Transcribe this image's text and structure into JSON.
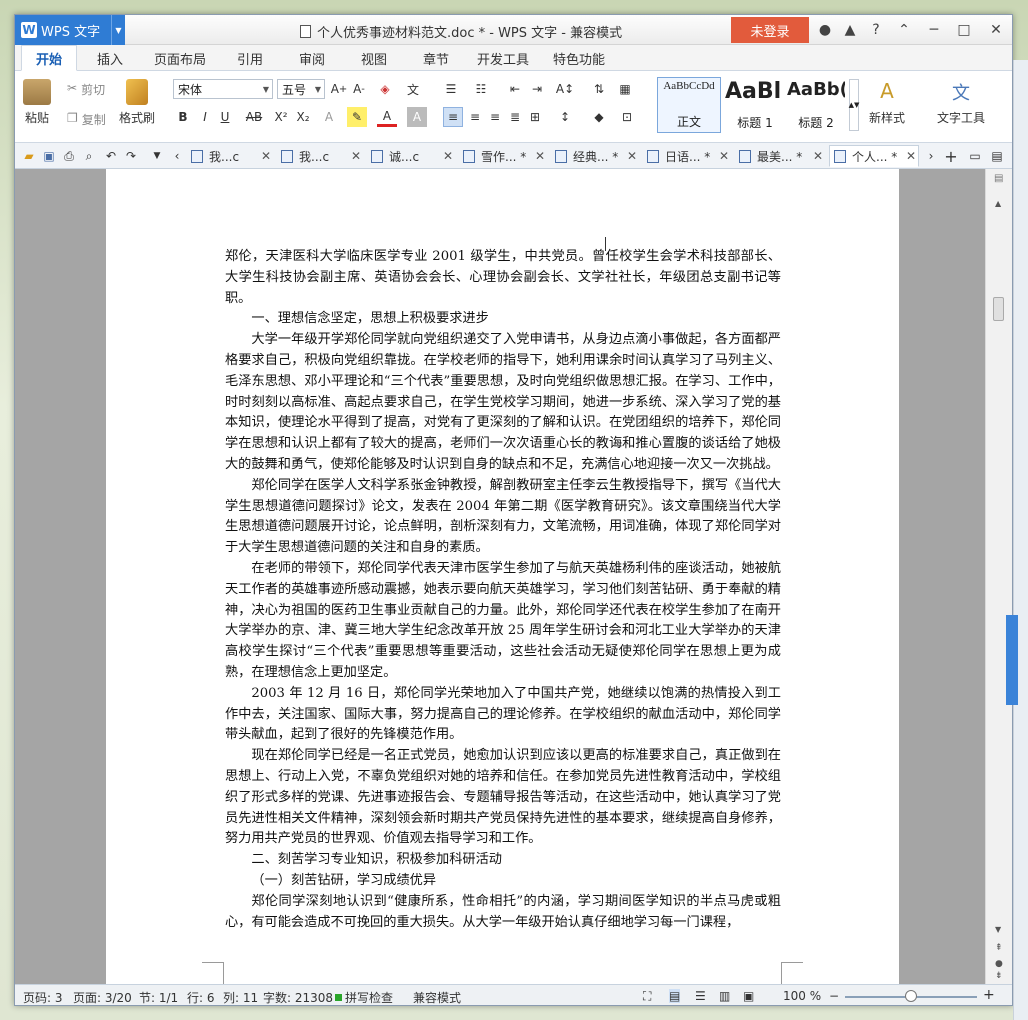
{
  "app": {
    "name": "WPS 文字",
    "logo_letter": "W",
    "doc_title": "个人优秀事迹材料范文.doc * - WPS 文字 - 兼容模式",
    "login_label": "未登录"
  },
  "menu": {
    "tabs": [
      "开始",
      "插入",
      "页面布局",
      "引用",
      "审阅",
      "视图",
      "章节",
      "开发工具",
      "特色功能"
    ],
    "active": "开始"
  },
  "ribbon": {
    "paste": "粘贴",
    "cut": "剪切",
    "copy": "复制",
    "format_painter": "格式刷",
    "font_name": "宋体",
    "font_size": "五号",
    "styles": [
      {
        "preview": "AaBbCcDd",
        "label": "正文"
      },
      {
        "preview": "AaBl",
        "label": "标题 1"
      },
      {
        "preview": "AaBb(",
        "label": "标题 2"
      }
    ],
    "new_style": "新样式",
    "text_tools": "文字工具"
  },
  "doc_tabs": [
    {
      "label": "我...c"
    },
    {
      "label": "我...c"
    },
    {
      "label": "诚...c"
    },
    {
      "label": "雪作... *"
    },
    {
      "label": "经典... *"
    },
    {
      "label": "日语... *"
    },
    {
      "label": "最美... *"
    },
    {
      "label": "个人... *",
      "active": true
    }
  ],
  "document": {
    "paragraphs": [
      {
        "text": "郑伦，天津医科大学临床医学专业 2001 级学生，中共党员。曾任校学生会学术科技部部长、大学生科技协会副主席、英语协会会长、心理协会副会长、文学社社长，年级团总支副书记等职。",
        "indent": false
      },
      {
        "text": "一、理想信念坚定，思想上积极要求进步",
        "indent": true
      },
      {
        "text": "大学一年级开学郑伦同学就向党组织递交了入党申请书，从身边点滴小事做起，各方面都严格要求自己，积极向党组织靠拢。在学校老师的指导下，她利用课余时间认真学习了马列主义、毛泽东思想、邓小平理论和“三个代表”重要思想，及时向党组织做思想汇报。在学习、工作中，时时刻刻以高标准、高起点要求自己，在学生党校学习期间，她进一步系统、深入学习了党的基本知识，使理论水平得到了提高，对党有了更深刻的了解和认识。在党团组织的培养下，郑伦同学在思想和认识上都有了较大的提高，老师们一次次语重心长的教诲和推心置腹的谈话给了她极大的鼓舞和勇气，使郑伦能够及时认识到自身的缺点和不足，充满信心地迎接一次又一次挑战。",
        "indent": true
      },
      {
        "text": "郑伦同学在医学人文科学系张金钟教授，解剖教研室主任李云生教授指导下，撰写《当代大学生思想道德问题探讨》论文，发表在 2004 年第二期《医学教育研究》。该文章围绕当代大学生思想道德问题展开讨论，论点鲜明，剖析深刻有力，文笔流畅，用词准确，体现了郑伦同学对于大学生思想道德问题的关注和自身的素质。",
        "indent": true
      },
      {
        "text": "在老师的带领下，郑伦同学代表天津市医学生参加了与航天英雄杨利伟的座谈活动，她被航天工作者的英雄事迹所感动震撼，她表示要向航天英雄学习，学习他们刻苦钻研、勇于奉献的精神，决心为祖国的医药卫生事业贡献自己的力量。此外，郑伦同学还代表在校学生参加了在南开大学举办的京、津、冀三地大学生纪念改革开放 25 周年学生研讨会和河北工业大学举办的天津高校学生探讨“三个代表”重要思想等重要活动，这些社会活动无疑使郑伦同学在思想上更为成熟，在理想信念上更加坚定。",
        "indent": true
      },
      {
        "text": "2003 年 12 月 16 日，郑伦同学光荣地加入了中国共产党，她继续以饱满的热情投入到工作中去，关注国家、国际大事，努力提高自己的理论修养。在学校组织的献血活动中，郑伦同学带头献血，起到了很好的先锋模范作用。",
        "indent": true
      },
      {
        "text": "现在郑伦同学已经是一名正式党员，她愈加认识到应该以更高的标准要求自己，真正做到在思想上、行动上入党，不辜负党组织对她的培养和信任。在参加党员先进性教育活动中，学校组织了形式多样的党课、先进事迹报告会、专题辅导报告等活动，在这些活动中，她认真学习了党员先进性相关文件精神，深刻领会新时期共产党员保持先进性的基本要求，继续提高自身修养，努力用共产党员的世界观、价值观去指导学习和工作。",
        "indent": true
      },
      {
        "text": "二、刻苦学习专业知识，积极参加科研活动",
        "indent": true
      },
      {
        "text": "（一）刻苦钻研，学习成绩优异",
        "indent": true
      },
      {
        "text": "郑伦同学深刻地认识到“健康所系，性命相托”的内涵，学习期间医学知识的半点马虎或粗心，有可能会造成不可挽回的重大损失。从大学一年级开始认真仔细地学习每一门课程，",
        "indent": true
      }
    ]
  },
  "status": {
    "page": "页码: 3",
    "pages": "页面: 3/20",
    "section": "节: 1/1",
    "row": "行: 6",
    "col": "列: 11",
    "words": "字数: 21308",
    "spell": "拼写检查",
    "mode": "兼容模式",
    "zoom": "100 %",
    "zoom_value": 0.5
  }
}
